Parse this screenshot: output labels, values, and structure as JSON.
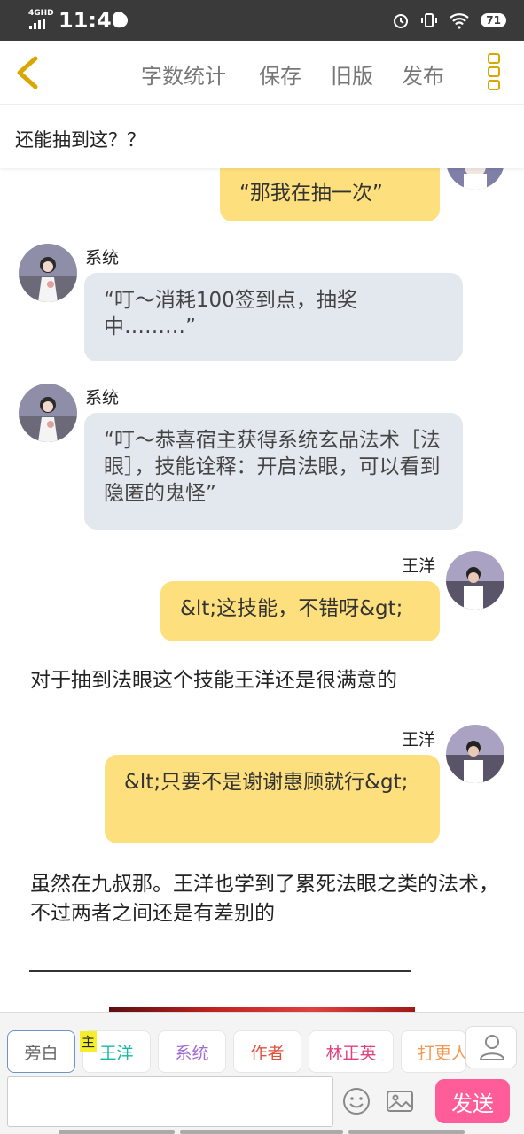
{
  "status": {
    "network": "4GHD",
    "time": "11:40",
    "battery": "71"
  },
  "toolbar": {
    "word_count": "字数统计",
    "save": "保存",
    "old_version": "旧版",
    "publish": "发布"
  },
  "topic": "还能抽到这？？",
  "messages": [
    {
      "side": "right",
      "text": "“那我在抽一次”"
    },
    {
      "side": "left",
      "name": "系统",
      "text": "“叮～消耗100签到点，抽奖中………”"
    },
    {
      "side": "left",
      "name": "系统",
      "text": "“叮～恭喜宿主获得系统玄品法术［法眼］，技能诠释：开启法眼，可以看到隐匿的鬼怪”"
    },
    {
      "side": "right",
      "name": "王洋",
      "text": "&lt;这技能，不错呀&gt;"
    },
    {
      "narration": "对于抽到法眼这个技能王洋还是很满意的"
    },
    {
      "side": "right",
      "name": "王洋",
      "text": "&lt;只要不是谢谢惠顾就行&gt;"
    },
    {
      "narration": "虽然在九叔那。王洋也学到了累死法眼之类的法术，不过两者之间还是有差别的"
    }
  ],
  "roles": [
    {
      "label": "旁白",
      "color": "#666666"
    },
    {
      "label": "王洋",
      "color": "#19b8a6",
      "badge": "主"
    },
    {
      "label": "系统",
      "color": "#a36bd1"
    },
    {
      "label": "作者",
      "color": "#e0503c"
    },
    {
      "label": "林正英",
      "color": "#e0417e"
    },
    {
      "label": "打更人",
      "color": "#f29a55"
    }
  ],
  "composer": {
    "input_value": "",
    "send": "发送"
  },
  "colors": {
    "accent_yellow": "#fde07d",
    "send_pink": "#ff5c9a",
    "bubble_grey": "#e3e8ef"
  }
}
